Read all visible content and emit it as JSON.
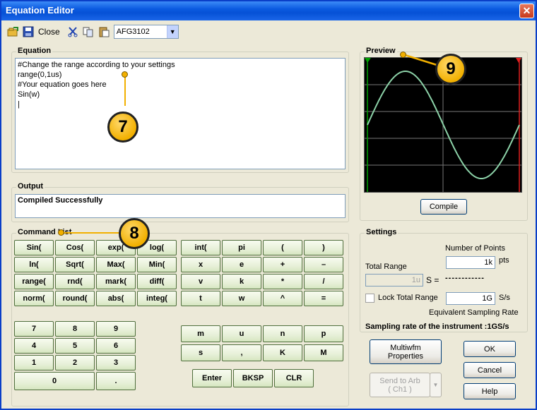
{
  "window": {
    "title": "Equation Editor",
    "close_glyph": "✕"
  },
  "toolbar": {
    "close_label": "Close",
    "model": "AFG3102",
    "icons": [
      "open-icon",
      "save-icon",
      "cut-icon",
      "copy-icon",
      "paste-icon"
    ]
  },
  "equation": {
    "legend": "Equation",
    "text": "#Change the range according to your settings\nrange(0,1us)\n#Your equation goes here\nSin(w)\n|"
  },
  "preview": {
    "legend": "Preview",
    "compile_label": "Compile"
  },
  "output": {
    "legend": "Output",
    "text": "Compiled Successfully"
  },
  "commands": {
    "legend": "Command List",
    "rows": [
      [
        "Sin(",
        "Cos(",
        "exp(",
        "log(",
        "int(",
        "pi",
        "(",
        ")"
      ],
      [
        "ln(",
        "Sqrt(",
        "Max(",
        "Min(",
        "x",
        "e",
        "+",
        "–"
      ],
      [
        "range(",
        "rnd(",
        "mark(",
        "diff(",
        "v",
        "k",
        "*",
        "/"
      ],
      [
        "norm(",
        "round(",
        "abs(",
        "integ(",
        "t",
        "w",
        "^",
        "="
      ]
    ],
    "numpad": [
      [
        "7",
        "8",
        "9"
      ],
      [
        "4",
        "5",
        "6"
      ],
      [
        "1",
        "2",
        "3"
      ]
    ],
    "zero": "0",
    "dot": ".",
    "unit_row1": [
      "m",
      "u",
      "n",
      "p"
    ],
    "unit_row2": [
      "s",
      ",",
      "K",
      "M"
    ],
    "enter": "Enter",
    "bksp": "BKSP",
    "clr": "CLR"
  },
  "settings": {
    "legend": "Settings",
    "num_points_label": "Number of Points",
    "num_points_value": "1k",
    "pts_unit": "pts",
    "total_range_label": "Total Range",
    "total_range_value": "1u",
    "s_eq": "S =",
    "dashes": "------------",
    "lock_label": "Lock Total Range",
    "rate_value": "1G",
    "rate_unit": "S/s",
    "equiv_label": "Equivalent Sampling Rate",
    "instrument_rate": "Sampling rate of the instrument :1GS/s"
  },
  "buttons": {
    "multiwfm": "Multiwfm\nProperties",
    "ok": "OK",
    "cancel": "Cancel",
    "send": "Send to Arb\n( Ch1 )",
    "help": "Help"
  },
  "callouts": [
    "7",
    "8",
    "9"
  ],
  "colors": {
    "accent": "#0B5AE0",
    "callout": "#F2B000",
    "wave": "#8CD2A8",
    "marker_left": "#00A000",
    "marker_right": "#E02020"
  }
}
